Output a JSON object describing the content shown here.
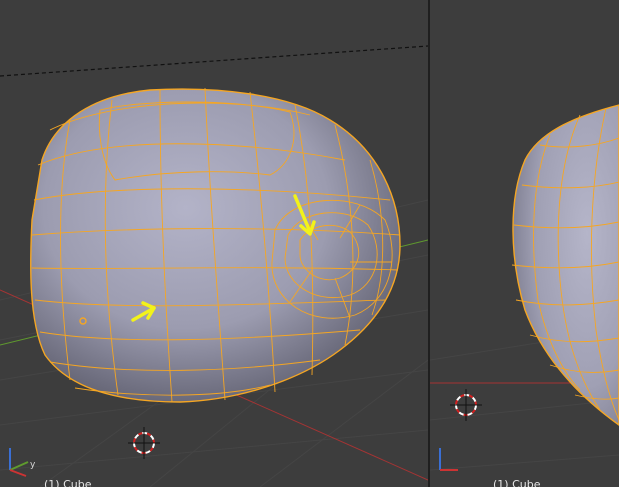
{
  "viewports": {
    "left": {
      "object_label": "(1) Cube"
    },
    "right": {
      "object_label": "(1) Cube"
    }
  },
  "axis_gizmo": {
    "y_label": "y"
  },
  "colors": {
    "background": "#3d3d3d",
    "wire": "#f5a623",
    "arrow": "#f2f21a",
    "grid": "#4a4a4a",
    "x_axis": "#a53434",
    "y_axis": "#5f9a2e"
  },
  "icons": {
    "cursor": "3d-cursor-icon",
    "annotation": "yellow-arrow-icon",
    "gizmo": "axis-gizmo-icon"
  }
}
